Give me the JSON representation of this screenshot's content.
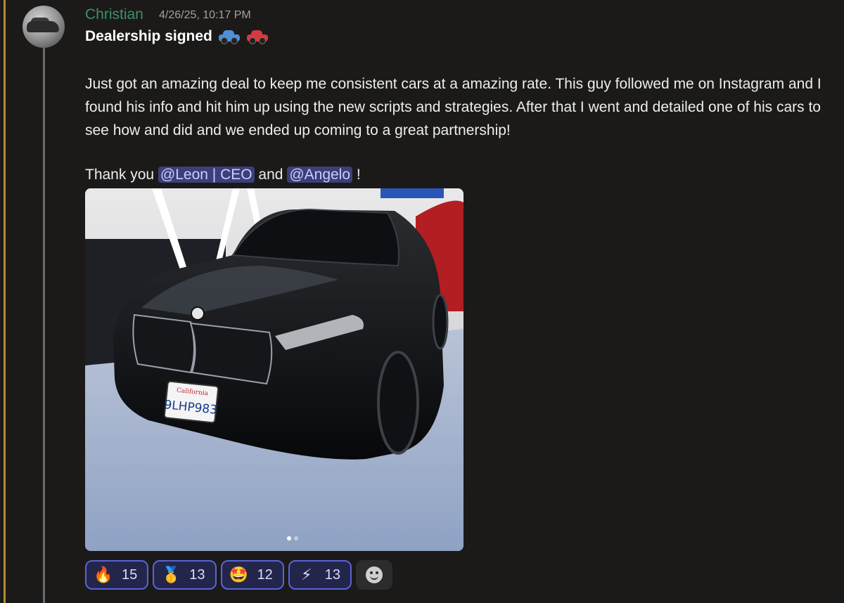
{
  "post": {
    "author": "Christian",
    "timestamp": "4/26/25, 10:17 PM",
    "title": "Dealership signed",
    "title_emojis": [
      "blue-car-icon",
      "red-car-icon"
    ],
    "body": "Just got an amazing deal to keep me consistent cars at a amazing rate. This guy followed me on Instagram and I found his info and hit him up using the new scripts and strategies. After that I went and detailed one of his cars to see how and did and we ended up coming to a great partnership!",
    "thanks_prefix": "Thank you",
    "mention_1": "@Leon | CEO",
    "thanks_and": "and",
    "mention_2": "@Angelo",
    "thanks_suffix": "!"
  },
  "photo": {
    "plate": "9LHP983",
    "plate_state": "California"
  },
  "reactions": [
    {
      "icon": "fire-icon",
      "glyph": "🔥",
      "count": "15"
    },
    {
      "icon": "medal-icon",
      "glyph": "🥇",
      "count": "13"
    },
    {
      "icon": "star-struck-icon",
      "glyph": "🤩",
      "count": "12"
    },
    {
      "icon": "lightning-icon",
      "glyph": "⚡",
      "count": "13"
    }
  ],
  "colors": {
    "author": "#3e8f66",
    "mention_bg": "#3b3f7a",
    "reaction_border": "#5a63d6"
  }
}
